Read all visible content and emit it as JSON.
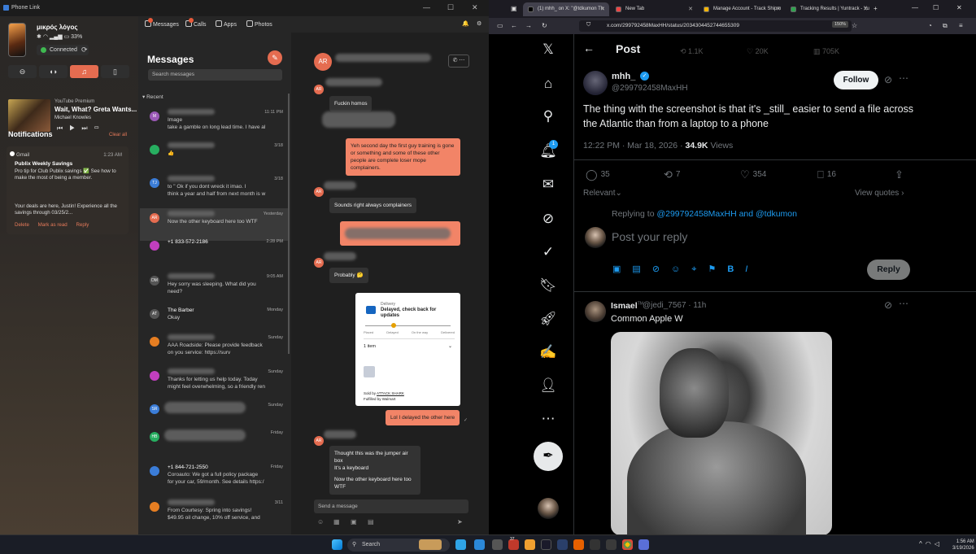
{
  "phone_link": {
    "window_title": "Phone Link",
    "device_name": "μικρός λόγος",
    "battery": "33%",
    "connection_status": "Connected",
    "media": {
      "source": "YouTube Premium",
      "title": "Wait, What? Greta Wants...",
      "artist": "Michael Knowles"
    },
    "notifications_title": "Notifications",
    "clear_all": "Clear all",
    "notification": {
      "app": "Gmail",
      "time": "1:23 AM",
      "title": "Publix Weekly Savings",
      "body": "Pro tip for Club Publix savings ✅ See how to make the most of being a member.",
      "body2": "Your deals are here, Justin! Experience all the savings through 03/25/2...",
      "actions": [
        "Delete",
        "Mark as read",
        "Reply"
      ]
    },
    "tabs": [
      {
        "label": "Messages",
        "badge": "2"
      },
      {
        "label": "Calls",
        "badge": "13"
      },
      {
        "label": "Apps"
      },
      {
        "label": "Photos"
      }
    ],
    "top_badge": "9",
    "messages_title": "Messages",
    "search_placeholder": "Search messages",
    "recent_label": "Recent",
    "conversations": [
      {
        "initials": "M",
        "name": "",
        "time": "11:11 PM",
        "preview": "Image\ntake a gamble on long lead time. I have al",
        "color": "#9b59b6"
      },
      {
        "initials": "",
        "name": "",
        "time": "3/18",
        "preview": "👍",
        "color": "#27ae60"
      },
      {
        "initials": "TJ",
        "name": "",
        "time": "3/18",
        "preview": "to \" Ok if you dont wreck it imao. I\nthink a year and half from next month is w",
        "color": "#3b7dd8"
      },
      {
        "initials": "AR",
        "name": "",
        "time": "Yesterday",
        "preview": "Now the other keyboard here too WTF",
        "color": "#e56c50"
      },
      {
        "initials": "",
        "name": "+1 833-572-2186",
        "time": "2:28 PM",
        "preview": "",
        "color": "#c13fbf"
      },
      {
        "initials": "DM",
        "name": "",
        "time": "9:05 AM",
        "preview": "Hey sorry was sleeping. What did you\nneed?",
        "color": "#555"
      },
      {
        "initials": "AT",
        "name": "The Barber",
        "time": "Monday",
        "preview": "Okay",
        "color": "#555"
      },
      {
        "initials": "",
        "name": "",
        "time": "Sunday",
        "preview": "AAA Roadside: Please provide feedback\non you                  service: https://surv",
        "color": "#e67e22"
      },
      {
        "initials": "",
        "name": "",
        "time": "Sunday",
        "preview": "Thanks for letting us help today. Today\nmight feel overwhelming, so a friendly ren",
        "color": "#c13fbf"
      },
      {
        "initials": "SR",
        "name": "",
        "time": "Sunday",
        "preview": "",
        "color": "#3b7dd8"
      },
      {
        "initials": "HB",
        "name": "",
        "time": "Friday",
        "preview": "",
        "color": "#27ae60"
      },
      {
        "initials": "",
        "name": "+1 844-721-2550",
        "time": "Friday",
        "preview": "Coroauto: We got a full policy package\nfor your car, 59/month. See details https:/",
        "color": "#3b7dd8"
      },
      {
        "initials": "",
        "name": "",
        "time": "3/11",
        "preview": "From Courtesy: Spring into savings!\n$49.95 oil change, 10% off service, and mo",
        "color": "#e67e22"
      }
    ],
    "chat": {
      "avatar": "AR",
      "messages": [
        {
          "dir": "in",
          "text": "Fuckin homos"
        },
        {
          "dir": "out",
          "text": "Yeh second day the first guy training is gone or something and some of these other people are complete loser mope complainers."
        },
        {
          "dir": "in",
          "text": "Sounds right always complainers"
        },
        {
          "dir": "in",
          "text": "Probably 🤔"
        },
        {
          "dir": "out",
          "text": "Lol I delayed the other here"
        },
        {
          "dir": "in",
          "text": "Thought this was the jumper air box\nIt's a keyboard"
        },
        {
          "dir": "in",
          "text": "Now the other keyboard here too\nWTF"
        }
      ],
      "card": {
        "label": "Delivery",
        "title": "Delayed, check back for updates",
        "steps": [
          "Placed",
          "Delayed",
          "On the way",
          "Delivered"
        ],
        "items": "1 item",
        "sold_by_prefix": "Sold by",
        "sold_by": "ATTACK SHARK",
        "fulfilled": "Fulfilled by Walmart"
      },
      "send_placeholder": "Send a message"
    }
  },
  "browser": {
    "tabs": [
      {
        "title": "(1) mhh_ on X: \"@tdkumon Th",
        "active": true,
        "color": "#000"
      },
      {
        "title": "New Tab",
        "active": false,
        "color": "#e44"
      },
      {
        "title": "Manage Account - Track Shipm",
        "active": false,
        "color": "#f5b400"
      },
      {
        "title": "Tracking Results | Yuntrack - Yu",
        "active": false,
        "color": "#2ea44f"
      }
    ],
    "url": "x.com/299792458MaxHH/status/2034304452744655309",
    "zoom": "150%"
  },
  "x": {
    "header": "Post",
    "ghost_counts": [
      "1.1K",
      "20K",
      "705K"
    ],
    "nav_badge": "1",
    "author": {
      "name": "mhh_",
      "handle": "@299792458MaxHH"
    },
    "follow": "Follow",
    "text": "The thing with the screenshot is that it's _still_ easier to send a file across the Atlantic than from a laptop to a phone",
    "time": "12:22 PM · Mar 18, 2026 ·",
    "views": "34.9K",
    "views_label": "Views",
    "stats": {
      "replies": "35",
      "reposts": "7",
      "likes": "354",
      "bookmarks": "16"
    },
    "relevant": "Relevant",
    "view_quotes": "View quotes",
    "replying_prefix": "Replying to",
    "replying_to": "@299792458MaxHH and @tdkumon",
    "reply_placeholder": "Post your reply",
    "reply_button": "Reply",
    "comment": {
      "name": "Ismael",
      "mark": "TM",
      "handle": "@jedi_7567 · 11h",
      "text": "Common Apple W"
    }
  },
  "taskbar": {
    "search": "Search",
    "time": "1:56 AM",
    "date": "3/19/2026",
    "badge": "37"
  }
}
